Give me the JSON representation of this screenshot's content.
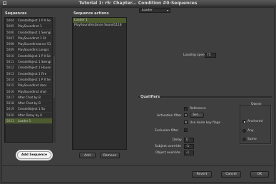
{
  "window": {
    "title": "Tutorial 1: r5: Chapter... Condition #0-Sequences"
  },
  "sequences": {
    "header": "Sequences",
    "rows": [
      {
        "num": "5004",
        "name": "CreateObject 1 P II Se"
      },
      {
        "num": "5005",
        "name": "PlaySoundInst 1"
      },
      {
        "num": "5006",
        "name": "CreateObject 1 Swingi"
      },
      {
        "num": "5007",
        "name": "PlaySoundInst 1 St"
      },
      {
        "num": "5008",
        "name": "PlaySoundInstance S1"
      },
      {
        "num": "5009",
        "name": "PlaySoundIns Longsc"
      },
      {
        "num": "5010",
        "name": "CreateObject 1 P II Se"
      },
      {
        "num": "5011",
        "name": "CreateObject 1 Swingi"
      },
      {
        "num": "5012",
        "name": "CreateObject 1 House"
      },
      {
        "num": "5013",
        "name": "CreateObject 1 Fire"
      },
      {
        "num": "5014",
        "name": "CreateObject 1 P II Se"
      },
      {
        "num": "5015",
        "name": "PlaySoundInst door"
      },
      {
        "num": "5016",
        "name": "PlaySoundInst shot"
      },
      {
        "num": "5017",
        "name": "After Chat by B"
      },
      {
        "num": "5018",
        "name": "After Chat by B"
      },
      {
        "num": "5019",
        "name": "CreateObject 1 Sa"
      },
      {
        "num": "5020",
        "name": "After Delay by 0"
      },
      {
        "num": "5021",
        "name": "Loader 1"
      }
    ],
    "add_button": "Add Sequence"
  },
  "actions": {
    "header": "Sequence actions",
    "rows": [
      "Loader 1",
      "PlaySoundInstance Sound1118"
    ],
    "add_button": "Add",
    "remove_button": "Remove"
  },
  "props": {
    "dropdown": "Loader",
    "loading_speed_label": "Loading speed",
    "loading_speed_value": "75"
  },
  "qualifiers": {
    "header": "Qualifiers",
    "reference_label": "Reference",
    "activation_filter_label": "Activation filter",
    "activation_filter_value": "Set...",
    "use_any_key_label": "Use Anim key flags",
    "exclusion_filter_label": "Exclusion filter",
    "delay_label": "Delay",
    "delay_value": "0",
    "subject_override_label": "Subject override",
    "subject_override_value": "-1",
    "object_override_label": "Object override",
    "object_override_value": "-1",
    "owner_header": "Owner",
    "owner_options": [
      "Anchored",
      "Any",
      "Same"
    ]
  },
  "footer": {
    "revert": "Revert",
    "cancel": "Cancel",
    "ok": "OK"
  }
}
